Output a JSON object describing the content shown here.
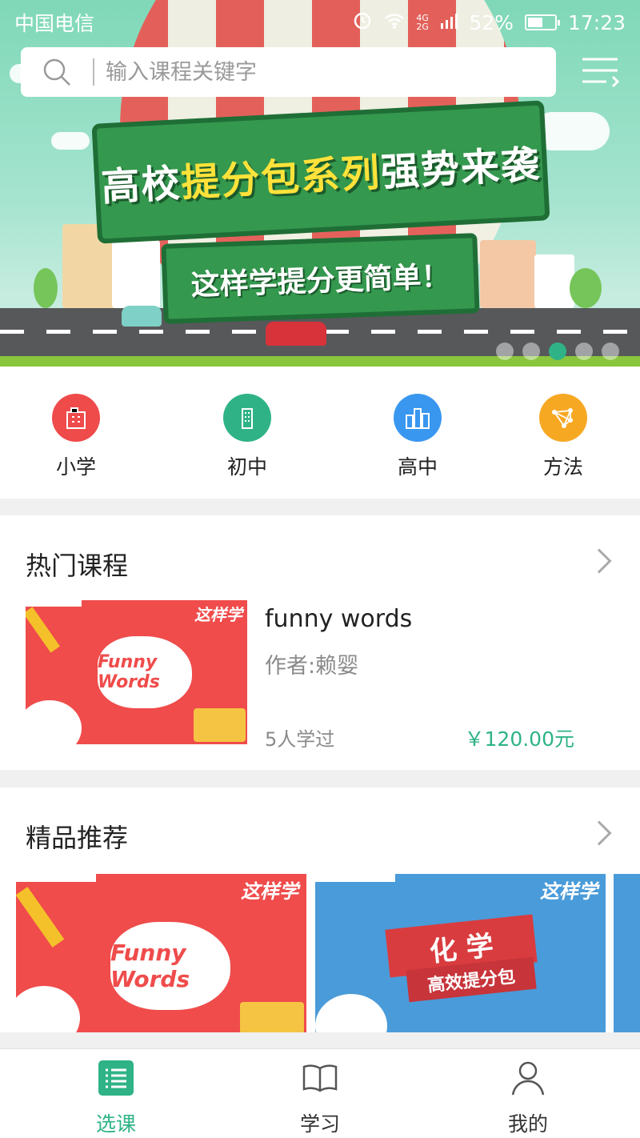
{
  "status_bar": {
    "carrier": "中国电信",
    "network": "4G 2G",
    "battery": "52%",
    "time": "17:23"
  },
  "search": {
    "placeholder": "输入课程关键字"
  },
  "banner": {
    "headline_parts": [
      "高校",
      "提分包系列",
      "强势来袭"
    ],
    "subline": "这样学提分更简单！",
    "active_slide": 3,
    "slide_count": 5
  },
  "categories": [
    {
      "label": "小学",
      "color": "#ef4b4b",
      "icon": "school-building-icon"
    },
    {
      "label": "初中",
      "color": "#2fb386",
      "icon": "tower-building-icon"
    },
    {
      "label": "高中",
      "color": "#3a97f0",
      "icon": "city-buildings-icon"
    },
    {
      "label": "方法",
      "color": "#f7a823",
      "icon": "network-nodes-icon"
    }
  ],
  "hot_courses": {
    "title": "热门课程",
    "course": {
      "title": "funny words",
      "author": "作者:赖婴",
      "learners": "5人学过",
      "price": "￥120.00元",
      "thumb_text": "Funny Words",
      "thumb_brand": "这样学"
    }
  },
  "recommended": {
    "title": "精品推荐",
    "cards": [
      {
        "color": "#ef4c4b",
        "label": "Funny Words",
        "brand": "这样学"
      },
      {
        "color": "#4a9bd9",
        "label": "化 学",
        "sublabel": "高效提分包",
        "brand": "这样学"
      }
    ]
  },
  "tabbar": [
    {
      "label": "选课",
      "icon": "list-icon",
      "active": true
    },
    {
      "label": "学习",
      "icon": "book-icon",
      "active": false
    },
    {
      "label": "我的",
      "icon": "user-icon",
      "active": false
    }
  ],
  "colors": {
    "accent": "#2fb386"
  }
}
